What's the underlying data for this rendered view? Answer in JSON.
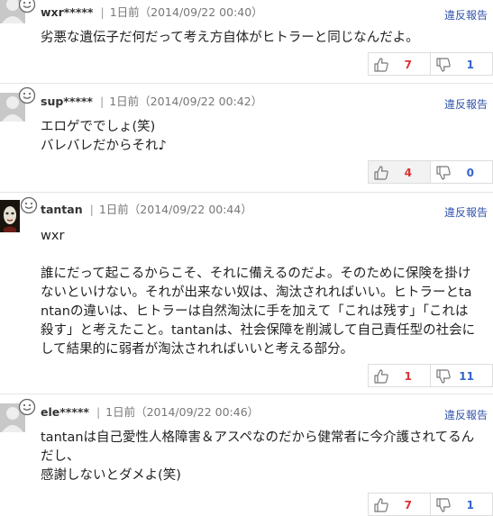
{
  "comments": [
    {
      "username": "wxr*****",
      "time": "1日前（2014/09/22 00:40）",
      "report": "違反報告",
      "lines": [
        "劣悪な遺伝子だ何だって考え方自体がヒトラーと同じなんだよ。"
      ],
      "likes": "7",
      "dislikes": "1",
      "avatar_icon": "default-user-icon"
    },
    {
      "username": "sup*****",
      "time": "1日前（2014/09/22 00:42）",
      "report": "違反報告",
      "lines": [
        "エロゲででしょ(笑)",
        "バレバレだからそれ♪"
      ],
      "likes": "4",
      "dislikes": "0",
      "avatar_icon": "default-user-icon"
    },
    {
      "username": "tantan",
      "time": "1日前（2014/09/22 00:44）",
      "report": "違反報告",
      "lines": [
        "wxr",
        "",
        "誰にだって起こるからこそ、それに備えるのだよ。そのために保険を掛け",
        "ないといけない。それが出来ない奴は、淘汰されればいい。ヒトラーとta",
        "ntanの違いは、ヒトラーは自然淘汰に手を加えて「これは残す」「これは",
        "殺す」と考えたこと。tantanは、社会保障を削減して自己責任型の社会に",
        "して結果的に弱者が淘汰されればいいと考える部分。"
      ],
      "likes": "1",
      "dislikes": "11",
      "avatar_icon": "mask-photo-icon"
    },
    {
      "username": "ele*****",
      "time": "1日前（2014/09/22 00:46）",
      "report": "違反報告",
      "lines": [
        "tantanは自己愛性人格障害＆アスペなのだから健常者に今介護されてるん",
        "だし、",
        "感謝しないとダメよ(笑)"
      ],
      "likes": "7",
      "dislikes": "1",
      "avatar_icon": "default-user-icon"
    }
  ],
  "colors": {
    "like_count": "#dd3333",
    "dislike_count": "#3366cc",
    "report_link": "#3355aa"
  }
}
